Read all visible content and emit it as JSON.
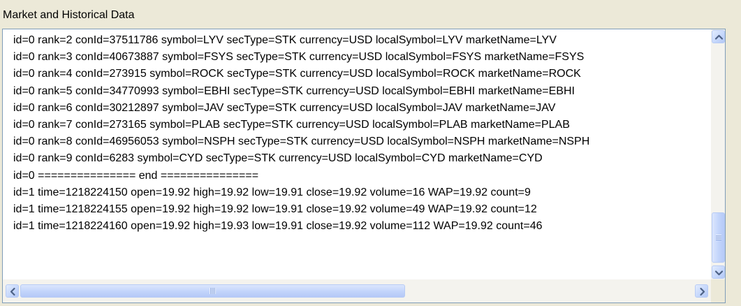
{
  "panel": {
    "title": "Market and Historical Data"
  },
  "log": {
    "lines": [
      "id=0 rank=2 conId=37511786 symbol=LYV secType=STK currency=USD localSymbol=LYV marketName=LYV",
      "id=0 rank=3 conId=40673887 symbol=FSYS secType=STK currency=USD localSymbol=FSYS marketName=FSYS",
      "id=0 rank=4 conId=273915 symbol=ROCK secType=STK currency=USD localSymbol=ROCK marketName=ROCK",
      "id=0 rank=5 conId=34770993 symbol=EBHI secType=STK currency=USD localSymbol=EBHI marketName=EBHI",
      "id=0 rank=6 conId=30212897 symbol=JAV secType=STK currency=USD localSymbol=JAV marketName=JAV",
      "id=0 rank=7 conId=273165 symbol=PLAB secType=STK currency=USD localSymbol=PLAB marketName=PLAB",
      "id=0 rank=8 conId=46956053 symbol=NSPH secType=STK currency=USD localSymbol=NSPH marketName=NSPH",
      "id=0 rank=9 conId=6283 symbol=CYD secType=STK currency=USD localSymbol=CYD marketName=CYD",
      "id=0 =============== end ===============",
      "id=1 time=1218224150 open=19.92 high=19.92 low=19.91 close=19.92 volume=16 WAP=19.92 count=9",
      "id=1 time=1218224155 open=19.92 high=19.92 low=19.91 close=19.92 volume=49 WAP=19.92 count=12",
      "id=1 time=1218224160 open=19.92 high=19.93 low=19.91 close=19.92 volume=112 WAP=19.92 count=46"
    ]
  },
  "scrollbars": {
    "up_icon": "arrow-up-icon",
    "down_icon": "arrow-down-icon",
    "left_icon": "arrow-left-icon",
    "right_icon": "arrow-right-icon"
  },
  "colors": {
    "panel_background": "#ece9d8",
    "listbox_border": "#7f9db9",
    "scroll_arrow": "#4d6185"
  }
}
